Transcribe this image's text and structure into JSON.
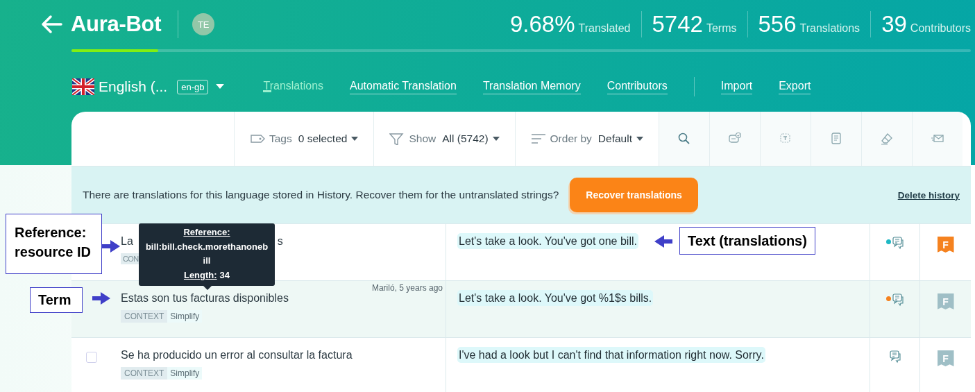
{
  "project": {
    "title": "Aura-Bot",
    "avatar": "TE"
  },
  "stats": [
    {
      "value": "9.68%",
      "label": "Translated"
    },
    {
      "value": "5742",
      "label": "Terms"
    },
    {
      "value": "556",
      "label": "Translations"
    },
    {
      "value": "39",
      "label": "Contributors"
    }
  ],
  "progress": {
    "level": 0.0968
  },
  "language": {
    "name": "English (...",
    "code": "en-gb"
  },
  "tabs": [
    {
      "label": "Translations",
      "selected": true
    },
    {
      "label": "Automatic Translation",
      "selected": false
    },
    {
      "label": "Translation Memory",
      "selected": false
    },
    {
      "label": "Contributors",
      "selected": false
    }
  ],
  "actions": [
    "Import",
    "Export"
  ],
  "filters": [
    {
      "kind": "tags",
      "label": "Tags",
      "value": "0 selected"
    },
    {
      "kind": "show",
      "label": "Show",
      "value": "All (5742)"
    },
    {
      "kind": "order",
      "label": "Order by",
      "value": "Default"
    }
  ],
  "tools": [
    {
      "kind": "search"
    },
    {
      "kind": "review"
    },
    {
      "kind": "term"
    },
    {
      "kind": "document"
    },
    {
      "kind": "eraser"
    },
    {
      "kind": "mail"
    }
  ],
  "banner": {
    "message": "There are translations for this language stored in History. Recover them for the untranslated strings?",
    "button": "Recover translations",
    "link": "Delete history"
  },
  "rows": [
    {
      "term_parts": [
        "La",
        "s"
      ],
      "context_label": "CON",
      "translation": "Let's take a look. You've got one bill.",
      "color": "#1fb8c4",
      "flagged": true,
      "highlighted": false,
      "flag_letter": "F"
    },
    {
      "term": "Estas son tus facturas disponibles",
      "meta": "Mariló, 5 years ago",
      "context_label": "CONTEXT",
      "context": "Simplify",
      "translation": "Let's take a look. You've got %1$s bills.",
      "color": "#f5821f",
      "flagged": false,
      "highlighted": true,
      "flag_letter": "F"
    },
    {
      "term": "Se ha producido un error al consultar la factura",
      "checked": false,
      "context_label": "CONTEXT",
      "context": "Simplify",
      "translation": "I've had a look but I can't find that information right now. Sorry.",
      "flagged": false,
      "highlighted": false,
      "flag_letter": "F"
    }
  ],
  "tooltip": {
    "title": "Reference:",
    "reference": "bill:bill.check.morethanonebill",
    "length_label": "Length:",
    "length": "34"
  },
  "annotations": [
    {
      "kind": "reference",
      "text": "Reference: resource ID"
    },
    {
      "kind": "term",
      "text": "Term"
    },
    {
      "kind": "text",
      "text": "Text (translations)"
    }
  ]
}
